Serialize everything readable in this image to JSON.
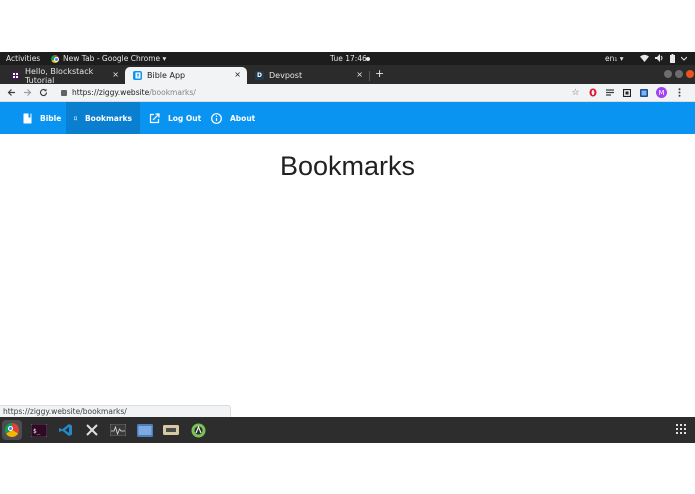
{
  "system_bar": {
    "activities": "Activities",
    "app_menu": "New Tab - Google Chrome ▾",
    "clock": "Tue 17:46",
    "language": "en₁ ▾"
  },
  "tabs": [
    {
      "title": "Hello, Blockstack Tutorial",
      "close": "×",
      "favicon": "blockstack-icon",
      "favicon_color": "#3f1d4d"
    },
    {
      "title": "Bible App",
      "close": "×",
      "favicon": "bible-icon",
      "favicon_color": "#0a94f2"
    },
    {
      "title": "Devpost",
      "close": "×",
      "favicon": "devpost-icon",
      "favicon_color": "#203b4f",
      "letter": "D"
    }
  ],
  "new_tab": "+",
  "address_bar": {
    "host": "https://ziggy.website",
    "path": "/bookmarks/"
  },
  "profile_letter": "M",
  "app_nav": {
    "items": [
      {
        "label": "Bible",
        "icon": "book-icon"
      },
      {
        "label": "Bookmarks",
        "icon": "bookmark-icon",
        "active": true
      },
      {
        "label": "Log Out",
        "icon": "external-link-icon"
      },
      {
        "label": "About",
        "icon": "info-icon"
      }
    ]
  },
  "page": {
    "title": "Bookmarks"
  },
  "status_url": "https://ziggy.website/bookmarks/",
  "dock_apps": [
    "chrome-icon",
    "terminal-icon",
    "vscode-icon",
    "tools-icon",
    "system-monitor-icon",
    "files-icon",
    "storage-icon",
    "android-studio-icon"
  ],
  "colors": {
    "app_nav": "#0a94f2",
    "app_nav_active": "#0a7fd0",
    "ubuntu_orange": "#e95420"
  }
}
